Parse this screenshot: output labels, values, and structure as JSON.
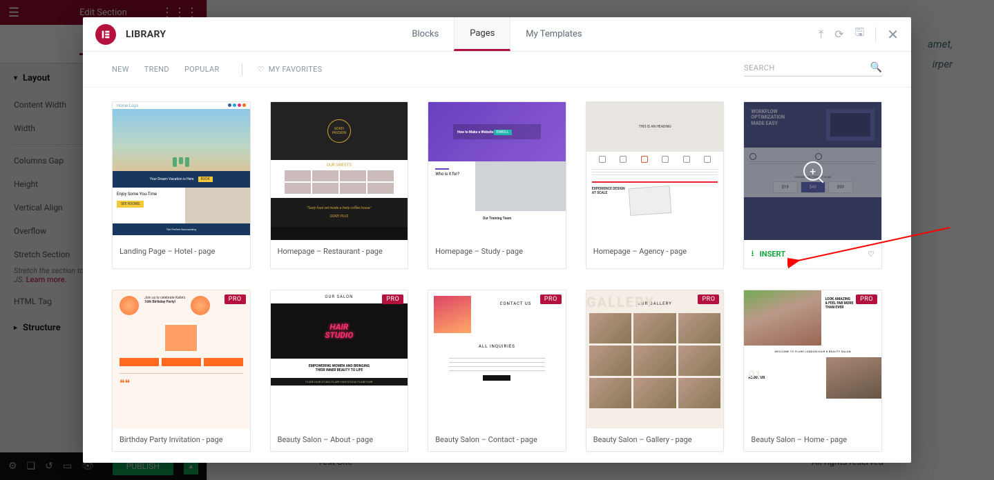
{
  "editor": {
    "header_title": "Edit Section",
    "tab_layout": "Layout",
    "section": "Layout",
    "controls": {
      "content_width": "Content Width",
      "width": "Width",
      "columns_gap": "Columns Gap",
      "height": "Height",
      "vertical_align": "Vertical Align",
      "overflow": "Overflow",
      "stretch_section": "Stretch Section",
      "stretch_desc": "Stretch the section to the full width of the page using JS.",
      "learn_more": "Learn more.",
      "html_tag": "HTML Tag",
      "structure": "Structure"
    },
    "publish": "PUBLISH",
    "bg_text1": "amet,",
    "bg_text2": "irper",
    "footer_left": "Test Site",
    "footer_right": "All rights reserved"
  },
  "modal": {
    "title": "LIBRARY",
    "tabs": {
      "blocks": "Blocks",
      "pages": "Pages",
      "mytemplates": "My Templates"
    },
    "filters": {
      "new": "NEW",
      "trend": "TREND",
      "popular": "POPULAR",
      "fav": "MY FAVORITES"
    },
    "search_placeholder": "SEARCH",
    "insert_label": "INSERT",
    "pro_label": "PRO",
    "cards": [
      {
        "title": "Landing Page – Hotel - page"
      },
      {
        "title": "Homepage – Restaurant - page"
      },
      {
        "title": "Homepage – Study - page"
      },
      {
        "title": "Homepage – Agency - page"
      },
      {
        "title": ""
      },
      {
        "title": "Birthday Party Invitation - page"
      },
      {
        "title": "Beauty Salon – About - page"
      },
      {
        "title": "Beauty Salon – Contact - page"
      },
      {
        "title": "Beauty Salon – Gallery - page"
      },
      {
        "title": "Beauty Salon – Home - page"
      }
    ]
  }
}
